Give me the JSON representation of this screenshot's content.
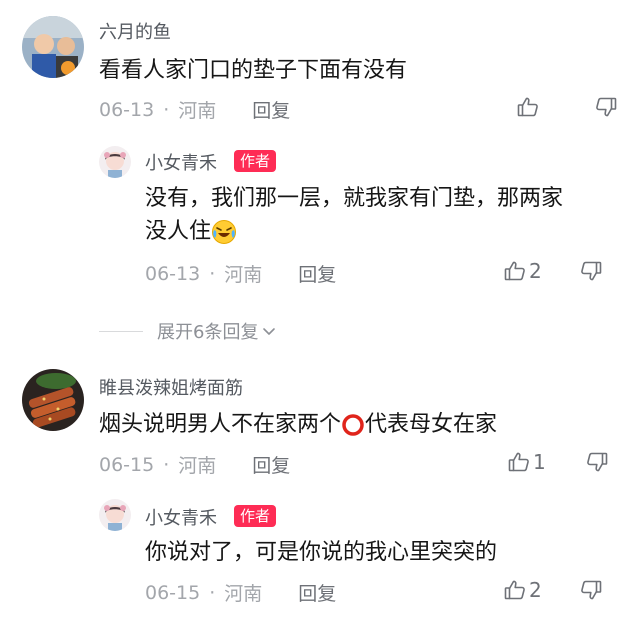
{
  "comments": [
    {
      "username": "六月的鱼",
      "text": "看看人家门口的垫子下面有没有",
      "date": "06-13",
      "location": "河南",
      "reply_label": "回复",
      "like_count": "",
      "replies": [
        {
          "username": "小女青禾",
          "badge": "作者",
          "text_line1": "没有，我们那一层，就我家有门垫，那两家",
          "text_line2": "没人住",
          "date": "06-13",
          "location": "河南",
          "reply_label": "回复",
          "like_count": "2"
        }
      ],
      "expand_label": "展开6条回复"
    },
    {
      "username": "睢县泼辣姐烤面筋",
      "text_before": "烟头说明男人不在家两个",
      "text_after": "代表母女在家",
      "date": "06-15",
      "location": "河南",
      "reply_label": "回复",
      "like_count": "1",
      "replies": [
        {
          "username": "小女青禾",
          "badge": "作者",
          "text": "你说对了，可是你说的我心里突突的",
          "date": "06-15",
          "location": "河南",
          "reply_label": "回复",
          "like_count": "2"
        }
      ]
    }
  ],
  "meta_separator": "·",
  "colors": {
    "badge": "#fe2c55",
    "name": "#555a61",
    "meta": "#a3a6ab"
  },
  "icons": {
    "like": "thumbs-up-icon",
    "dislike": "thumbs-down-icon",
    "expand": "chevron-down-icon",
    "emoji": "laughing-crying-emoji-icon",
    "circle": "red-circle-emoji-icon"
  }
}
